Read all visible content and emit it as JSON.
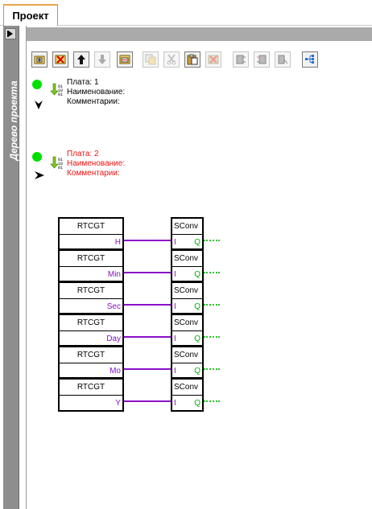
{
  "tab": {
    "label": "Проект"
  },
  "side_panel": {
    "title": "Дерево проекта"
  },
  "toolbar": {
    "buttons": [
      {
        "icon": "add-item-icon",
        "enabled": true
      },
      {
        "icon": "delete-red-icon",
        "enabled": true
      },
      {
        "icon": "move-up-icon",
        "enabled": true
      },
      {
        "icon": "move-down-icon",
        "enabled": false
      },
      {
        "icon": "import-icon",
        "enabled": true
      },
      {
        "icon": "copy-icon",
        "enabled": false
      },
      {
        "icon": "cut-icon",
        "enabled": false
      },
      {
        "icon": "paste-icon",
        "enabled": true
      },
      {
        "icon": "clear-icon",
        "enabled": false
      },
      {
        "icon": "align-left-icon",
        "enabled": false
      },
      {
        "icon": "align-right-icon",
        "enabled": false
      },
      {
        "icon": "wire-tool-icon",
        "enabled": false
      },
      {
        "icon": "tree-view-icon",
        "enabled": true
      }
    ]
  },
  "boards": [
    {
      "plate": "Плата: 1",
      "name": "Наименование:",
      "comment": "Комментарии:",
      "color": "#000000",
      "expanded": true
    },
    {
      "plate": "Плата: 2",
      "name": "Наименование:",
      "comment": "Комментарии:",
      "color": "#ee1111",
      "expanded": false
    }
  ],
  "diagram": {
    "left_blocks": [
      {
        "title": "RTCGT",
        "pin": "H"
      },
      {
        "title": "RTCGT",
        "pin": "Min"
      },
      {
        "title": "RTCGT",
        "pin": "Sec"
      },
      {
        "title": "RTCGT",
        "pin": "Day"
      },
      {
        "title": "RTCGT",
        "pin": "Mo"
      },
      {
        "title": "RTCGT",
        "pin": "Y"
      }
    ],
    "right_blocks": [
      {
        "title": "SConv",
        "in": "I",
        "out": "Q"
      },
      {
        "title": "SConv",
        "in": "I",
        "out": "Q"
      },
      {
        "title": "SConv",
        "in": "I",
        "out": "Q"
      },
      {
        "title": "SConv",
        "in": "I",
        "out": "Q"
      },
      {
        "title": "SConv",
        "in": "I",
        "out": "Q"
      },
      {
        "title": "SConv",
        "in": "I",
        "out": "Q"
      }
    ],
    "colors": {
      "wire": "#8b10c8",
      "output": "#00b400"
    }
  }
}
